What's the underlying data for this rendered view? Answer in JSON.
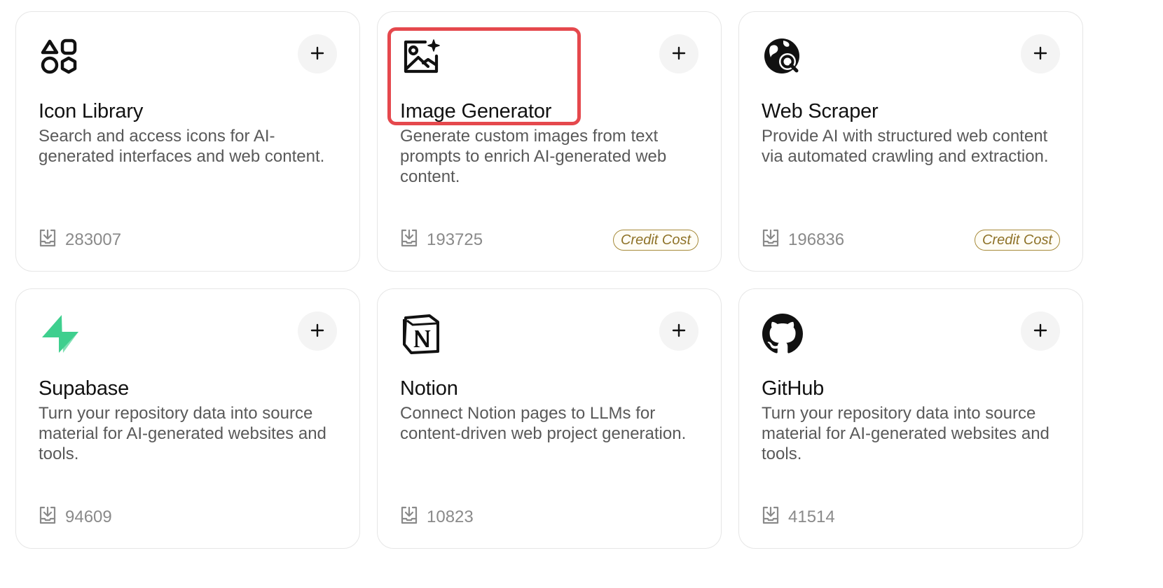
{
  "plugins": [
    {
      "title": "Icon Library",
      "description": "Search and access icons for AI-generated interfaces and web content.",
      "downloads": "283007",
      "badge": "",
      "icon": "shapes-icon",
      "add_label": "+"
    },
    {
      "title": "Image Generator",
      "description": "Generate custom images from text prompts to enrich AI-generated web content.",
      "downloads": "193725",
      "badge": "Credit Cost",
      "icon": "image-sparkle-icon",
      "add_label": "+"
    },
    {
      "title": "Web Scraper",
      "description": "Provide AI with structured web content via automated crawling and extraction.",
      "downloads": "196836",
      "badge": "Credit Cost",
      "icon": "globe-search-icon",
      "add_label": "+"
    },
    {
      "title": "Supabase",
      "description": "Turn your repository data into source material for AI-generated websites and tools.",
      "downloads": "94609",
      "badge": "",
      "icon": "supabase-logo-icon",
      "add_label": "+"
    },
    {
      "title": "Notion",
      "description": "Connect Notion pages to LLMs for content-driven web project generation.",
      "downloads": "10823",
      "badge": "",
      "icon": "notion-logo-icon",
      "add_label": "+"
    },
    {
      "title": "GitHub",
      "description": "Turn your repository data into source material for AI-generated websites and tools.",
      "downloads": "41514",
      "badge": "",
      "icon": "github-logo-icon",
      "add_label": "+"
    }
  ],
  "colors": {
    "highlight": "#e5484d",
    "badge_border": "#a68a3a",
    "supabase_green": "#3ecf8e"
  }
}
